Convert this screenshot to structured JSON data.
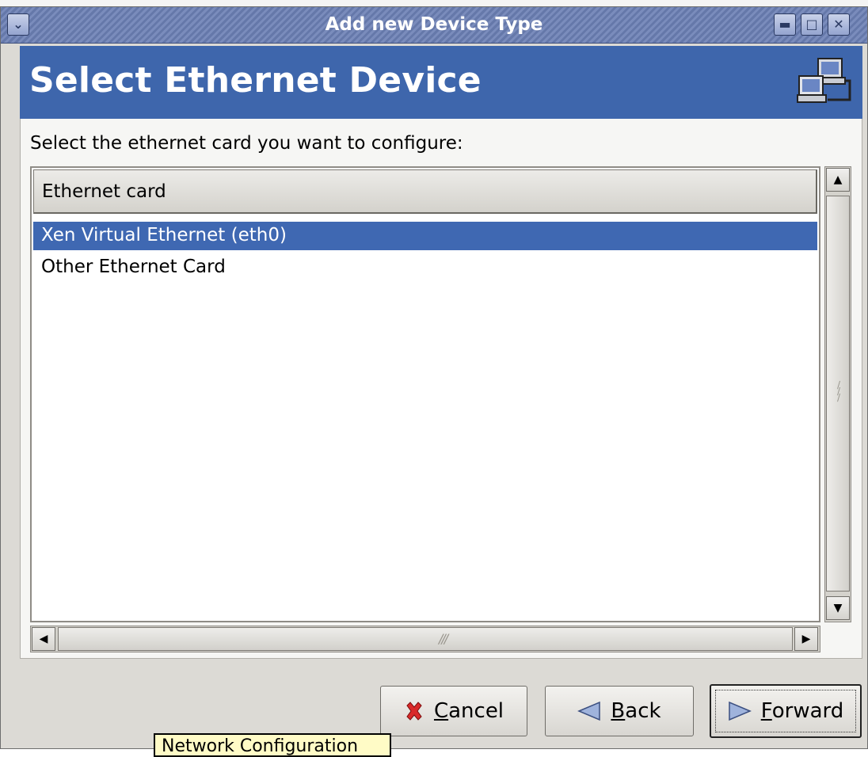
{
  "window": {
    "title": "Add new Device Type",
    "bleed_text": "▼  ... .. ... ..  .. .. ( .. )  . ."
  },
  "banner": {
    "heading": "Select Ethernet Device",
    "icon": "network-computers-icon"
  },
  "prompt": "Select the ethernet card you want to configure:",
  "list": {
    "column_header": "Ethernet card",
    "rows": [
      {
        "label": "Xen Virtual Ethernet (eth0)",
        "selected": true
      },
      {
        "label": "Other Ethernet Card",
        "selected": false
      }
    ]
  },
  "buttons": {
    "cancel": {
      "label": "Cancel",
      "mnemonic": "C",
      "rest": "ancel"
    },
    "back": {
      "label": "Back",
      "mnemonic": "B",
      "rest": "ack"
    },
    "forward": {
      "label": "Forward",
      "mnemonic": "F",
      "rest": "orward"
    }
  },
  "tooltip": {
    "text": "Network Configuration"
  },
  "colors": {
    "banner": "#3e66ac",
    "selection": "#3f68b2",
    "titlebar": "#6b7fb4"
  }
}
